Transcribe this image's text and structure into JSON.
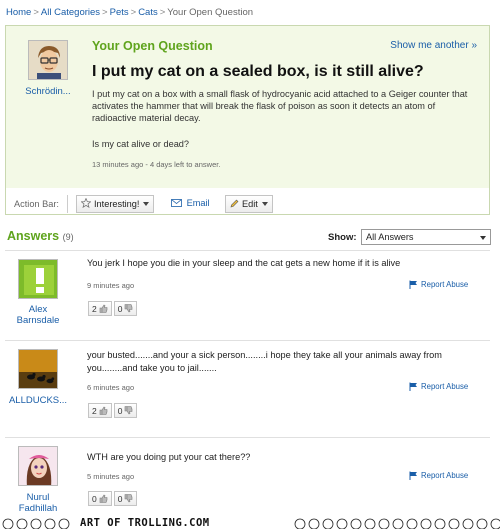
{
  "breadcrumb": {
    "items": [
      "Home",
      "All Categories",
      "Pets",
      "Cats"
    ],
    "current": "Your Open Question",
    "separator": ">"
  },
  "question": {
    "section_label": "Your Open Question",
    "show_another": "Show me another »",
    "asker_name": "Schrödin...",
    "title": "I put my cat on a sealed box, is it still alive?",
    "body": "I put my cat on a box with a small flask of hydrocyanic acid attached to a Geiger counter that activates the hammer that will break the flask of poison as soon it detects an atom of radioactive material decay.",
    "followup": "Is my cat alive or dead?",
    "meta": "13 minutes ago - 4 days left to answer."
  },
  "action_bar": {
    "label": "Action Bar:",
    "interesting": "Interesting!",
    "email": "Email",
    "edit": "Edit"
  },
  "answers_header": {
    "title": "Answers",
    "count": "(9)",
    "show_label": "Show:",
    "show_value": "All Answers"
  },
  "answers": [
    {
      "name": "Alex Barnsdale",
      "text": "You jerk I hope you die in your sleep and the cat gets a new home if it is alive",
      "time": "9 minutes ago",
      "report": "Report Abuse",
      "up": "2",
      "down": "0",
      "avatar_icon": "green-exclamation-avatar"
    },
    {
      "name": "ALLDUCKS...",
      "text": "your busted.......and your a sick person........i hope they take all your animals away from you........and take you to jail.......",
      "time": "6 minutes ago",
      "report": "Report Abuse",
      "up": "2",
      "down": "0",
      "avatar_icon": "ducks-sunset-avatar"
    },
    {
      "name": "Nurul Fadhillah",
      "text": "WTH are you doing put your cat there??",
      "time": "5 minutes ago",
      "report": "Report Abuse",
      "up": "0",
      "down": "0",
      "avatar_icon": "girl-avatar"
    }
  ],
  "watermark": {
    "text": "ART OF TROLLING.COM"
  },
  "colors": {
    "brand_green": "#5fa41d",
    "link_blue": "#1a5ea8",
    "question_bg": "#f3f9e6"
  }
}
